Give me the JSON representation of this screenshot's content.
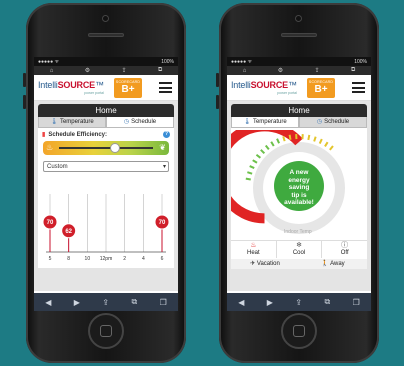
{
  "status": {
    "carrier": "●●●●● ᯤ",
    "battery": "100%"
  },
  "browser": {
    "icons": [
      "home-icon",
      "settings-icon",
      "up-icon",
      "tabs-icon"
    ],
    "nav_glyphs": [
      "◀",
      "▶",
      "⇪",
      "⧉",
      "❐"
    ]
  },
  "app": {
    "logo_prefix": "Intelli",
    "logo_main": "SOURCE",
    "logo_sub": "power portal",
    "scorecard_label": "SCORECARD",
    "scorecard_grade": "B+"
  },
  "page": {
    "title": "Home"
  },
  "tabs": [
    {
      "label": "Temperature",
      "icon": "thermometer-icon"
    },
    {
      "label": "Schedule",
      "icon": "clock-icon"
    }
  ],
  "schedule": {
    "efficiency_label": "Schedule Efficiency:",
    "efficiency_level": 0.55,
    "mode_select": "Custom",
    "chart_data": {
      "type": "scatter",
      "x_ticks": [
        "5",
        "8",
        "10",
        "12pm",
        "2",
        "4",
        "6"
      ],
      "points": [
        {
          "x": "5",
          "y": 70,
          "label": "70"
        },
        {
          "x": "8",
          "y": 62,
          "label": "62"
        },
        {
          "x": "6",
          "y": 70,
          "label": "70"
        }
      ]
    }
  },
  "thermostat": {
    "tip_text": "A new energy saving tip is available!",
    "tip_lines": [
      "A new",
      "energy saving",
      "tip is",
      "available!"
    ],
    "indoor_label": "Indoor Temp",
    "modes": [
      {
        "label": "Heat",
        "icon": "flame-icon",
        "glyph": "🔥"
      },
      {
        "label": "Cool",
        "icon": "snowflake-icon",
        "glyph": "❄"
      },
      {
        "label": "Off",
        "icon": "power-icon",
        "glyph": "⏻"
      }
    ],
    "vacation_label": "Vacation",
    "away_label": "Away"
  },
  "colors": {
    "background": "#1d7b84",
    "accent": "#f29b20",
    "heat": "#e02424",
    "tip": "#3faa3f"
  }
}
